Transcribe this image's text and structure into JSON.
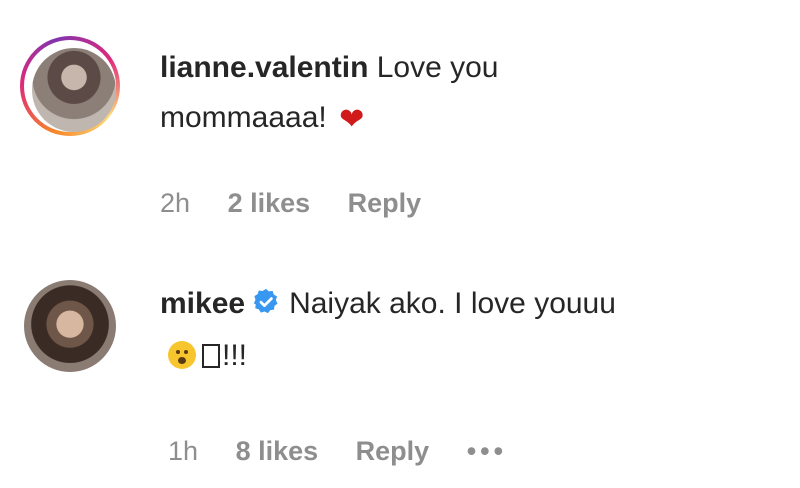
{
  "comments": [
    {
      "username": "lianne.valentin",
      "text_line1": "Love you",
      "text_line2": "mommaaaa!",
      "time": "2h",
      "likes": "2 likes",
      "reply": "Reply"
    },
    {
      "username": "mikee",
      "text_line1": "Naiyak ako. I love youuu",
      "text_line2": "!!!",
      "time": "1h",
      "likes": "8 likes",
      "reply": "Reply",
      "more": "•••"
    }
  ],
  "colors": {
    "text": "#262626",
    "muted": "#8e8e8e",
    "heart": "#d11a1a",
    "verified": "#3897f0"
  }
}
